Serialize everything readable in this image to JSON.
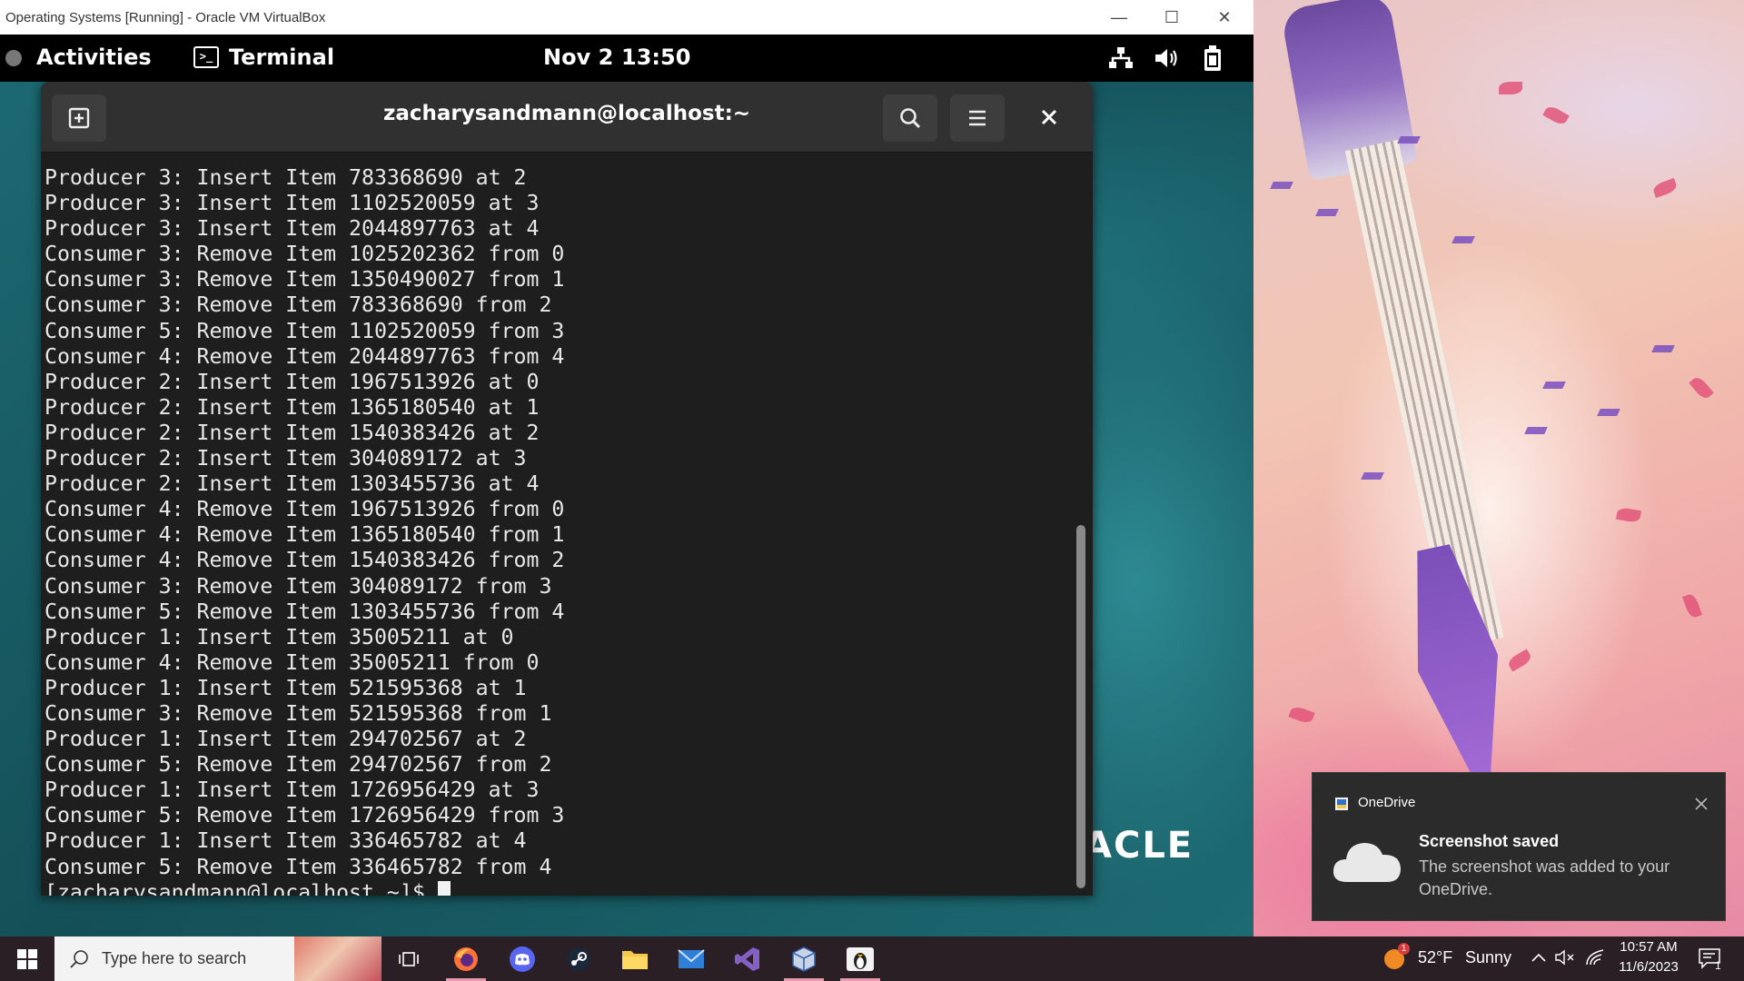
{
  "vbox": {
    "title": "Operating Systems [Running] - Oracle VM VirtualBox",
    "minimize": "—",
    "maximize": "☐",
    "close": "✕"
  },
  "gnome": {
    "activities": "Activities",
    "app_name": "Terminal",
    "date": "Nov 2",
    "time": "13:50",
    "wallpaper_logo": "ACLE"
  },
  "terminal": {
    "title": "zacharysandmann@localhost:~",
    "lines": [
      "Producer 3: Insert Item 783368690 at 2",
      "Producer 3: Insert Item 1102520059 at 3",
      "Producer 3: Insert Item 2044897763 at 4",
      "Consumer 3: Remove Item 1025202362 from 0",
      "Consumer 3: Remove Item 1350490027 from 1",
      "Consumer 3: Remove Item 783368690 from 2",
      "Consumer 5: Remove Item 1102520059 from 3",
      "Consumer 4: Remove Item 2044897763 from 4",
      "Producer 2: Insert Item 1967513926 at 0",
      "Producer 2: Insert Item 1365180540 at 1",
      "Producer 2: Insert Item 1540383426 at 2",
      "Producer 2: Insert Item 304089172 at 3",
      "Producer 2: Insert Item 1303455736 at 4",
      "Consumer 4: Remove Item 1967513926 from 0",
      "Consumer 4: Remove Item 1365180540 from 1",
      "Consumer 4: Remove Item 1540383426 from 2",
      "Consumer 3: Remove Item 304089172 from 3",
      "Consumer 5: Remove Item 1303455736 from 4",
      "Producer 1: Insert Item 35005211 at 0",
      "Consumer 4: Remove Item 35005211 from 0",
      "Producer 1: Insert Item 521595368 at 1",
      "Consumer 3: Remove Item 521595368 from 1",
      "Producer 1: Insert Item 294702567 at 2",
      "Consumer 5: Remove Item 294702567 from 2",
      "Producer 1: Insert Item 1726956429 at 3",
      "Consumer 5: Remove Item 1726956429 from 3",
      "Producer 1: Insert Item 336465782 at 4",
      "Consumer 5: Remove Item 336465782 from 4"
    ],
    "prompt": "[zacharysandmann@localhost ~]$"
  },
  "toast": {
    "app": "OneDrive",
    "title": "Screenshot saved",
    "message": "The screenshot was added to your OneDrive."
  },
  "taskbar": {
    "search_placeholder": "Type here to search",
    "weather_temp": "52°F",
    "weather_desc": "Sunny",
    "clock_time": "10:57 AM",
    "clock_date": "11/6/2023",
    "notification_count": "1",
    "weather_badge": "1"
  },
  "colors": {
    "terminal_bg": "#1e1e1e",
    "terminal_text": "#e8e8e8",
    "gnome_bar": "#000000",
    "taskbar": "#2a1f24"
  }
}
